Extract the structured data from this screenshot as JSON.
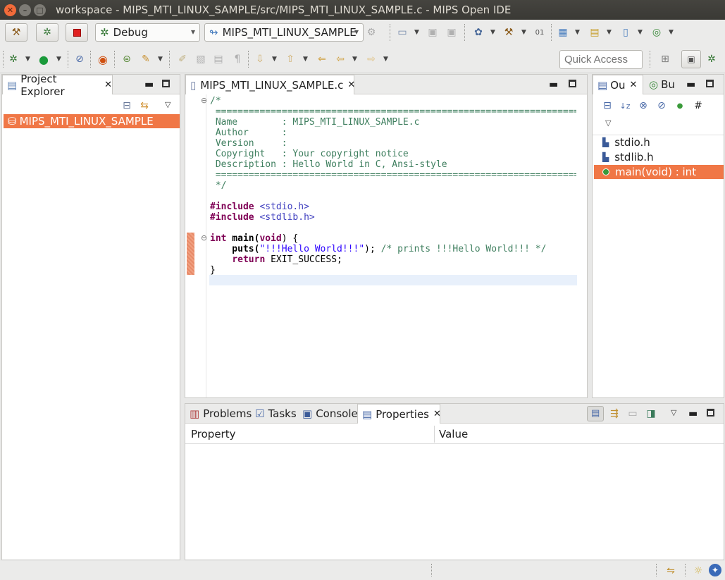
{
  "window": {
    "title": "workspace - MIPS_MTI_LINUX_SAMPLE/src/MIPS_MTI_LINUX_SAMPLE.c - MIPS Open IDE",
    "close_glyph": "✕",
    "minimize_glyph": "–",
    "maximize_glyph": "□"
  },
  "toolbar": {
    "build_config": "Debug",
    "launch_target": "MIPS_MTI_LINUX_SAMPLE",
    "quick_access_placeholder": "Quick Access"
  },
  "project_explorer": {
    "tab_label": "Project Explorer",
    "items": [
      {
        "label": "MIPS_MTI_LINUX_SAMPLE",
        "selected": true
      }
    ]
  },
  "editor": {
    "tab_label": "MIPS_MTI_LINUX_SAMPLE.c",
    "lines": [
      "/*",
      " ==========================================================================",
      " Name        : MIPS_MTI_LINUX_SAMPLE.c",
      " Author      :",
      " Version     :",
      " Copyright   : Your copyright notice",
      " Description : Hello World in C, Ansi-style",
      " ==========================================================================",
      " */",
      "",
      "#include",
      "#include",
      "",
      "int main(void) {",
      "    puts(\"!!!Hello World!!!\");",
      "    return EXIT_SUCCESS;",
      "}"
    ],
    "include1": "<stdio.h>",
    "include2": "<stdlib.h>",
    "kw_include": "#include",
    "kw_int": "int",
    "func_main": " main(",
    "kw_void": "void",
    "main_rest": ") {",
    "puts_call": "    puts(",
    "puts_str": "\"!!!Hello World!!!\"",
    "puts_end": "); ",
    "puts_comment": "/* prints !!!Hello World!!! */",
    "kw_return": "return",
    "return_rest": " EXIT_SUCCESS;",
    "close_brace": "}"
  },
  "outline": {
    "tab_outline": "Ou",
    "tab_build": "Bu",
    "items": [
      {
        "label": "stdio.h",
        "icon": "include-icon",
        "selected": false
      },
      {
        "label": "stdlib.h",
        "icon": "include-icon",
        "selected": false
      },
      {
        "label": "main(void) : int",
        "icon": "function-icon",
        "selected": true
      }
    ]
  },
  "bottom_panel": {
    "tabs": [
      {
        "label": "Problems",
        "active": false
      },
      {
        "label": "Tasks",
        "active": false
      },
      {
        "label": "Console",
        "active": false
      },
      {
        "label": "Properties",
        "active": true
      }
    ],
    "columns": [
      "Property",
      "Value"
    ]
  },
  "colors": {
    "selection": "#f07746",
    "comment": "#3f7f5f",
    "keyword": "#7f0055",
    "string": "#2a00ff"
  }
}
